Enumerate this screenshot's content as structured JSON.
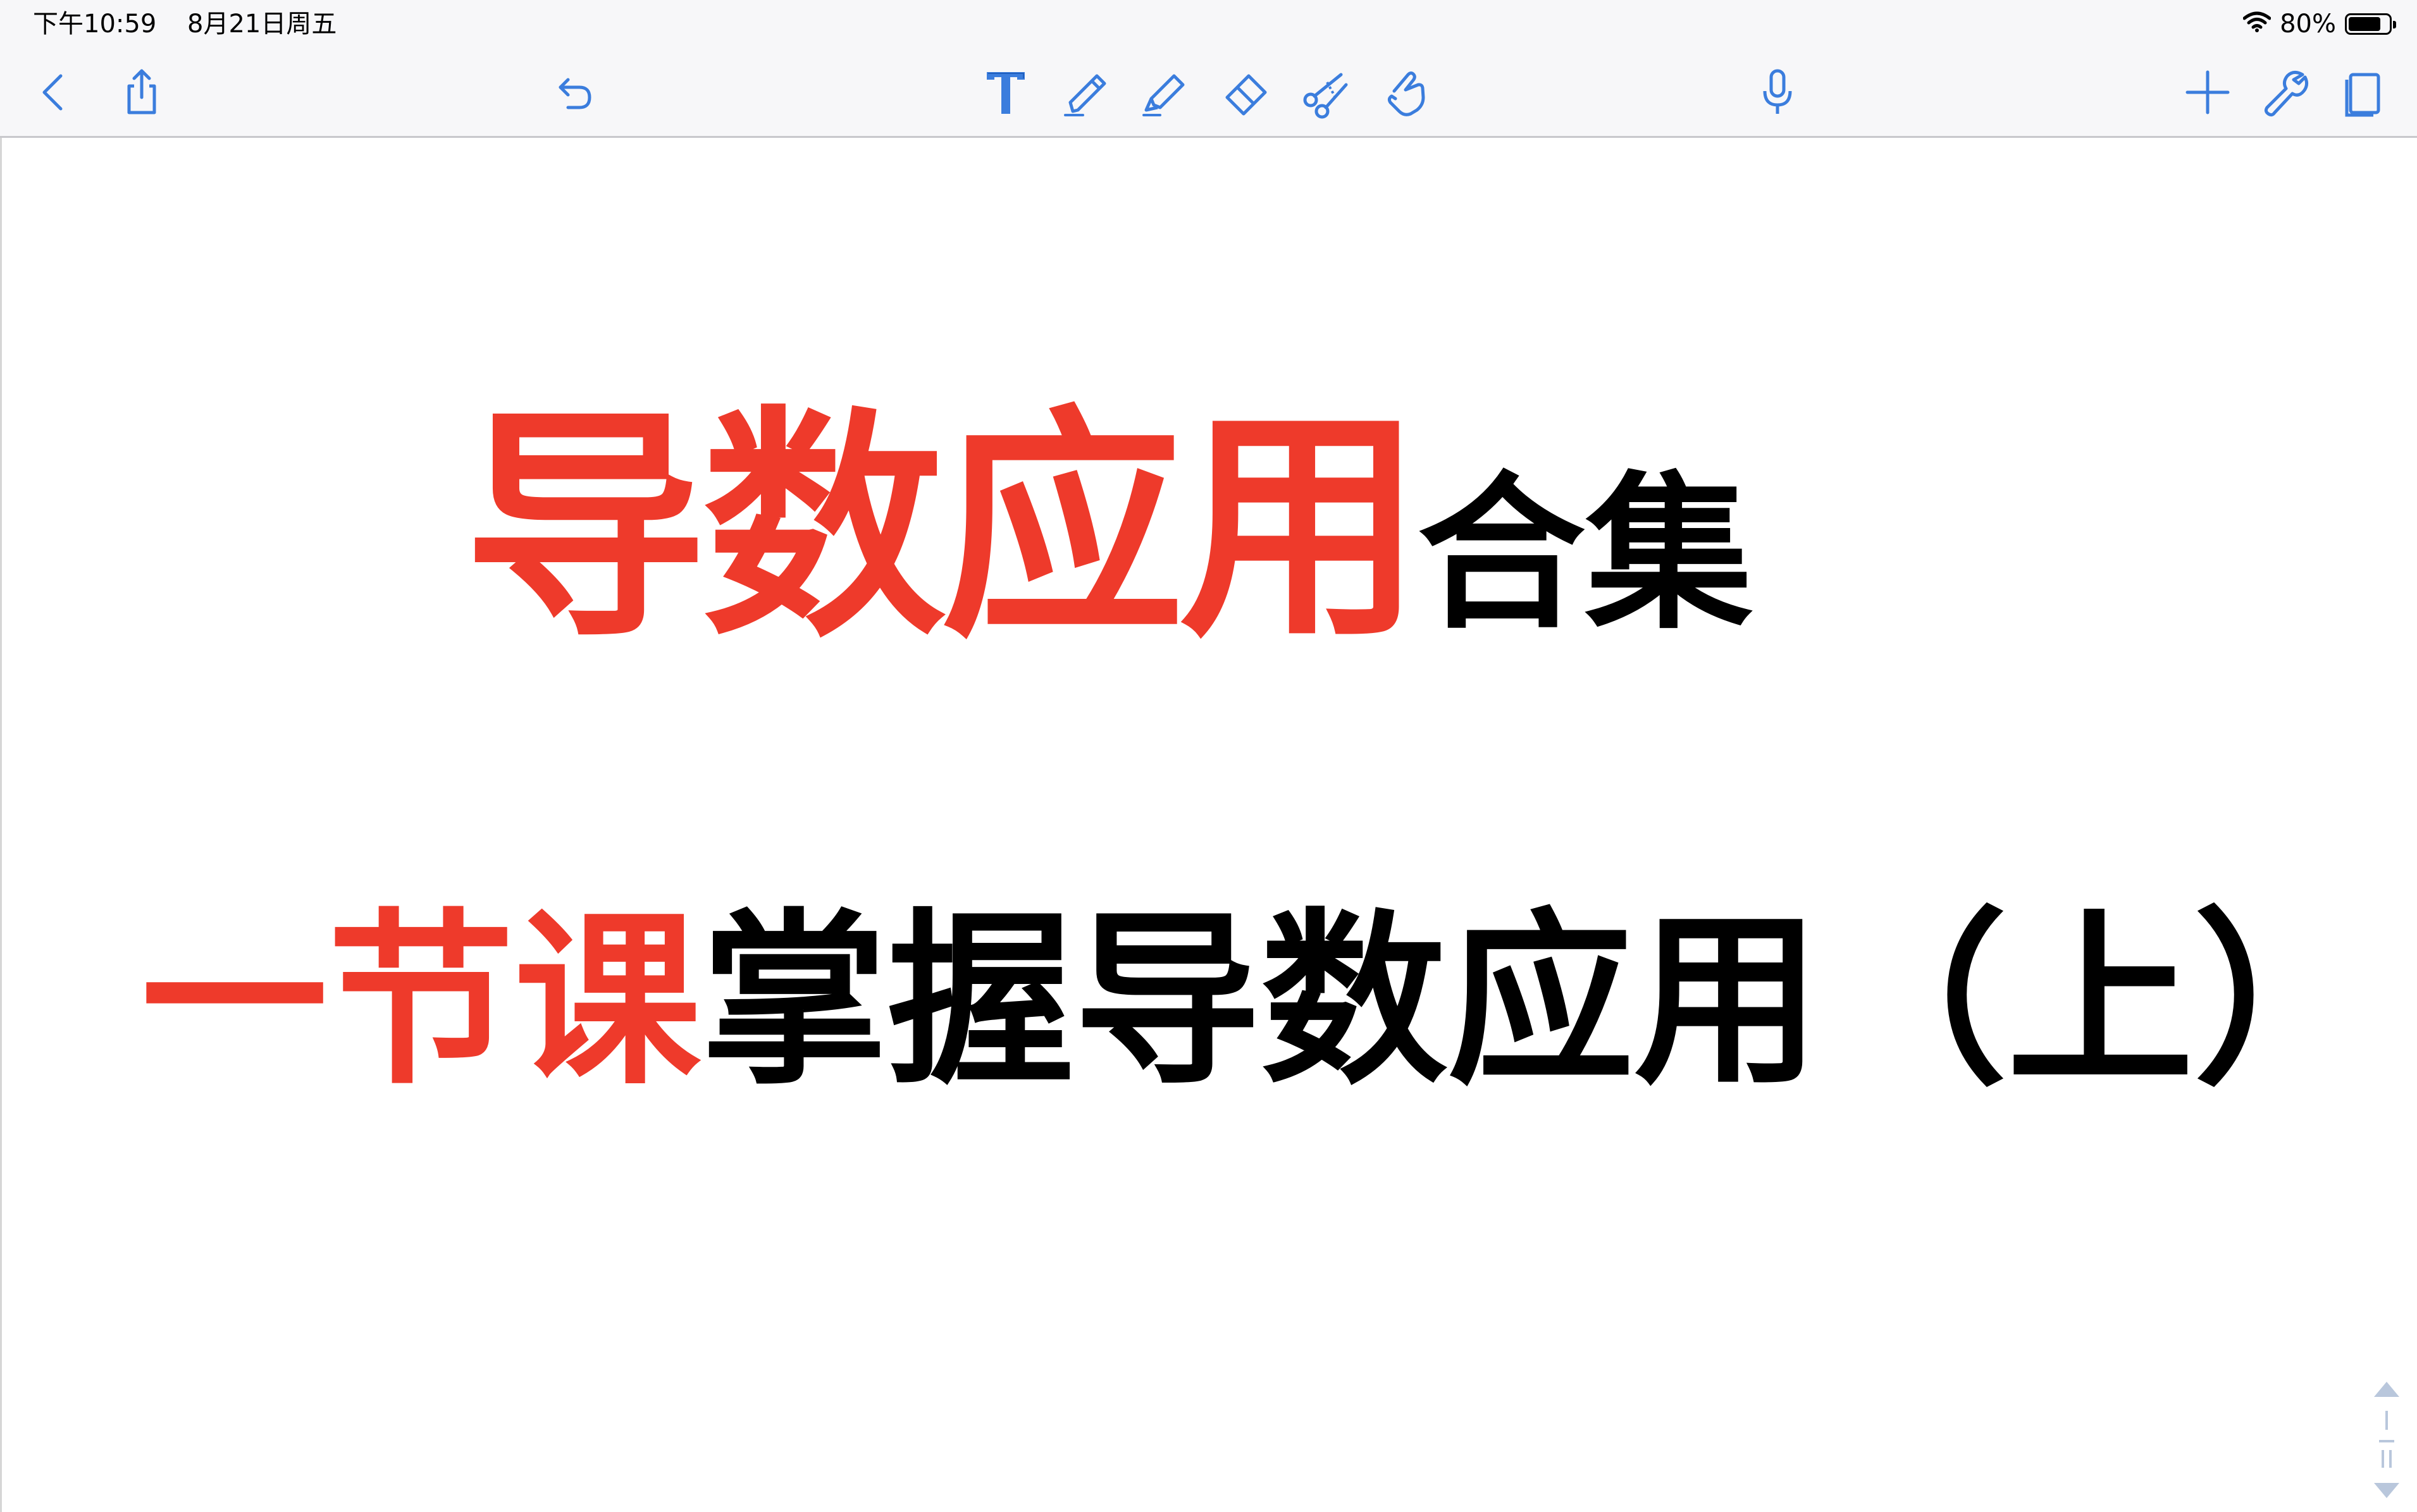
{
  "status_bar": {
    "time": "下午10:59",
    "date": "8月21日周五",
    "battery_text": "80%",
    "battery_level": 0.8,
    "wifi_icon": "wifi-icon",
    "battery_icon": "battery-icon"
  },
  "toolbar": {
    "left": [
      "back-icon",
      "share-icon",
      "undo-icon"
    ],
    "tools": [
      "text-tool-icon",
      "pen-icon",
      "highlighter-icon",
      "eraser-icon",
      "scissors-icon",
      "hand-pointer-icon"
    ],
    "center_right": [
      "microphone-icon"
    ],
    "right": [
      "add-icon",
      "wrench-icon",
      "pages-icon"
    ],
    "accent_color": "#3b7ddd"
  },
  "content": {
    "title_red": "导数应用",
    "title_black": "合集",
    "subtitle_red": "一节课",
    "subtitle_black": "掌握导数应用（上）",
    "red_color": "#ee3a2b",
    "black_color": "#000000"
  },
  "scroller": {
    "icon": "page-scroller-icon"
  }
}
